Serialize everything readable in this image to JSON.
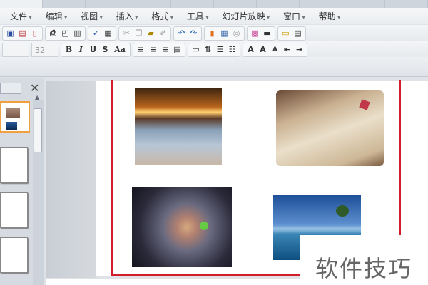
{
  "menu": [
    "文件",
    "编辑",
    "视图",
    "插入",
    "格式",
    "工具",
    "幻灯片放映",
    "窗口",
    "帮助"
  ],
  "toolbar": {
    "font_size": "32",
    "bold": "B",
    "italic": "I",
    "underline": "U",
    "shadow": "S",
    "change_case": "Aa",
    "font_color": "A",
    "grow": "A",
    "shrink": "A"
  },
  "watermark": "软件技巧",
  "photos": [
    "sunset-beach",
    "handwritten-note",
    "leaf-heart",
    "island-sea"
  ]
}
